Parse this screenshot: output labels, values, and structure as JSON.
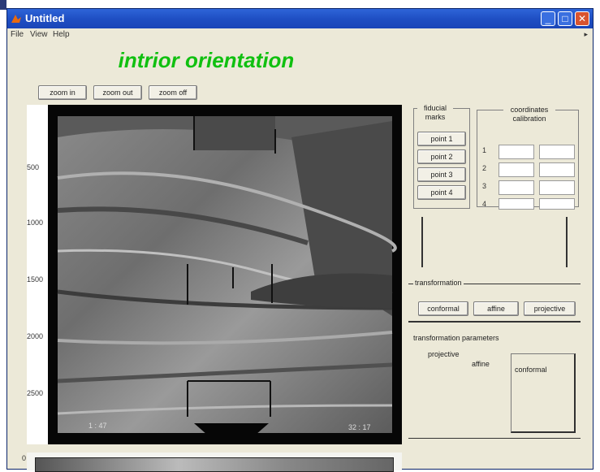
{
  "window": {
    "title": "Untitled"
  },
  "menu": [
    "File",
    "View",
    "Help"
  ],
  "heading": "intrior orientation",
  "toolbar": {
    "buttons": [
      "zoom in",
      "zoom out",
      "zoom off"
    ]
  },
  "image_axis": {
    "y_ticks": [
      "500",
      "1000",
      "1500",
      "2000",
      "2500"
    ],
    "corner_left": "1 : 47",
    "corner_right": "32 : 17",
    "bottom_strip_tick": "0"
  },
  "fiducial_panel": {
    "label": "fiducial marks",
    "buttons": [
      "point 1",
      "point 2",
      "point 3",
      "point 4"
    ]
  },
  "coordinate_panel": {
    "label": "coordinates calibration",
    "rows": [
      "1",
      "2",
      "3",
      "4"
    ]
  },
  "transformation_panel": {
    "label": "transformation",
    "buttons": [
      "conformal",
      "affine",
      "projective"
    ]
  },
  "results_panel": {
    "label": "transformation parameters",
    "sub_label": "projective",
    "sub_label_2": "affine",
    "box_label": "conformal"
  }
}
